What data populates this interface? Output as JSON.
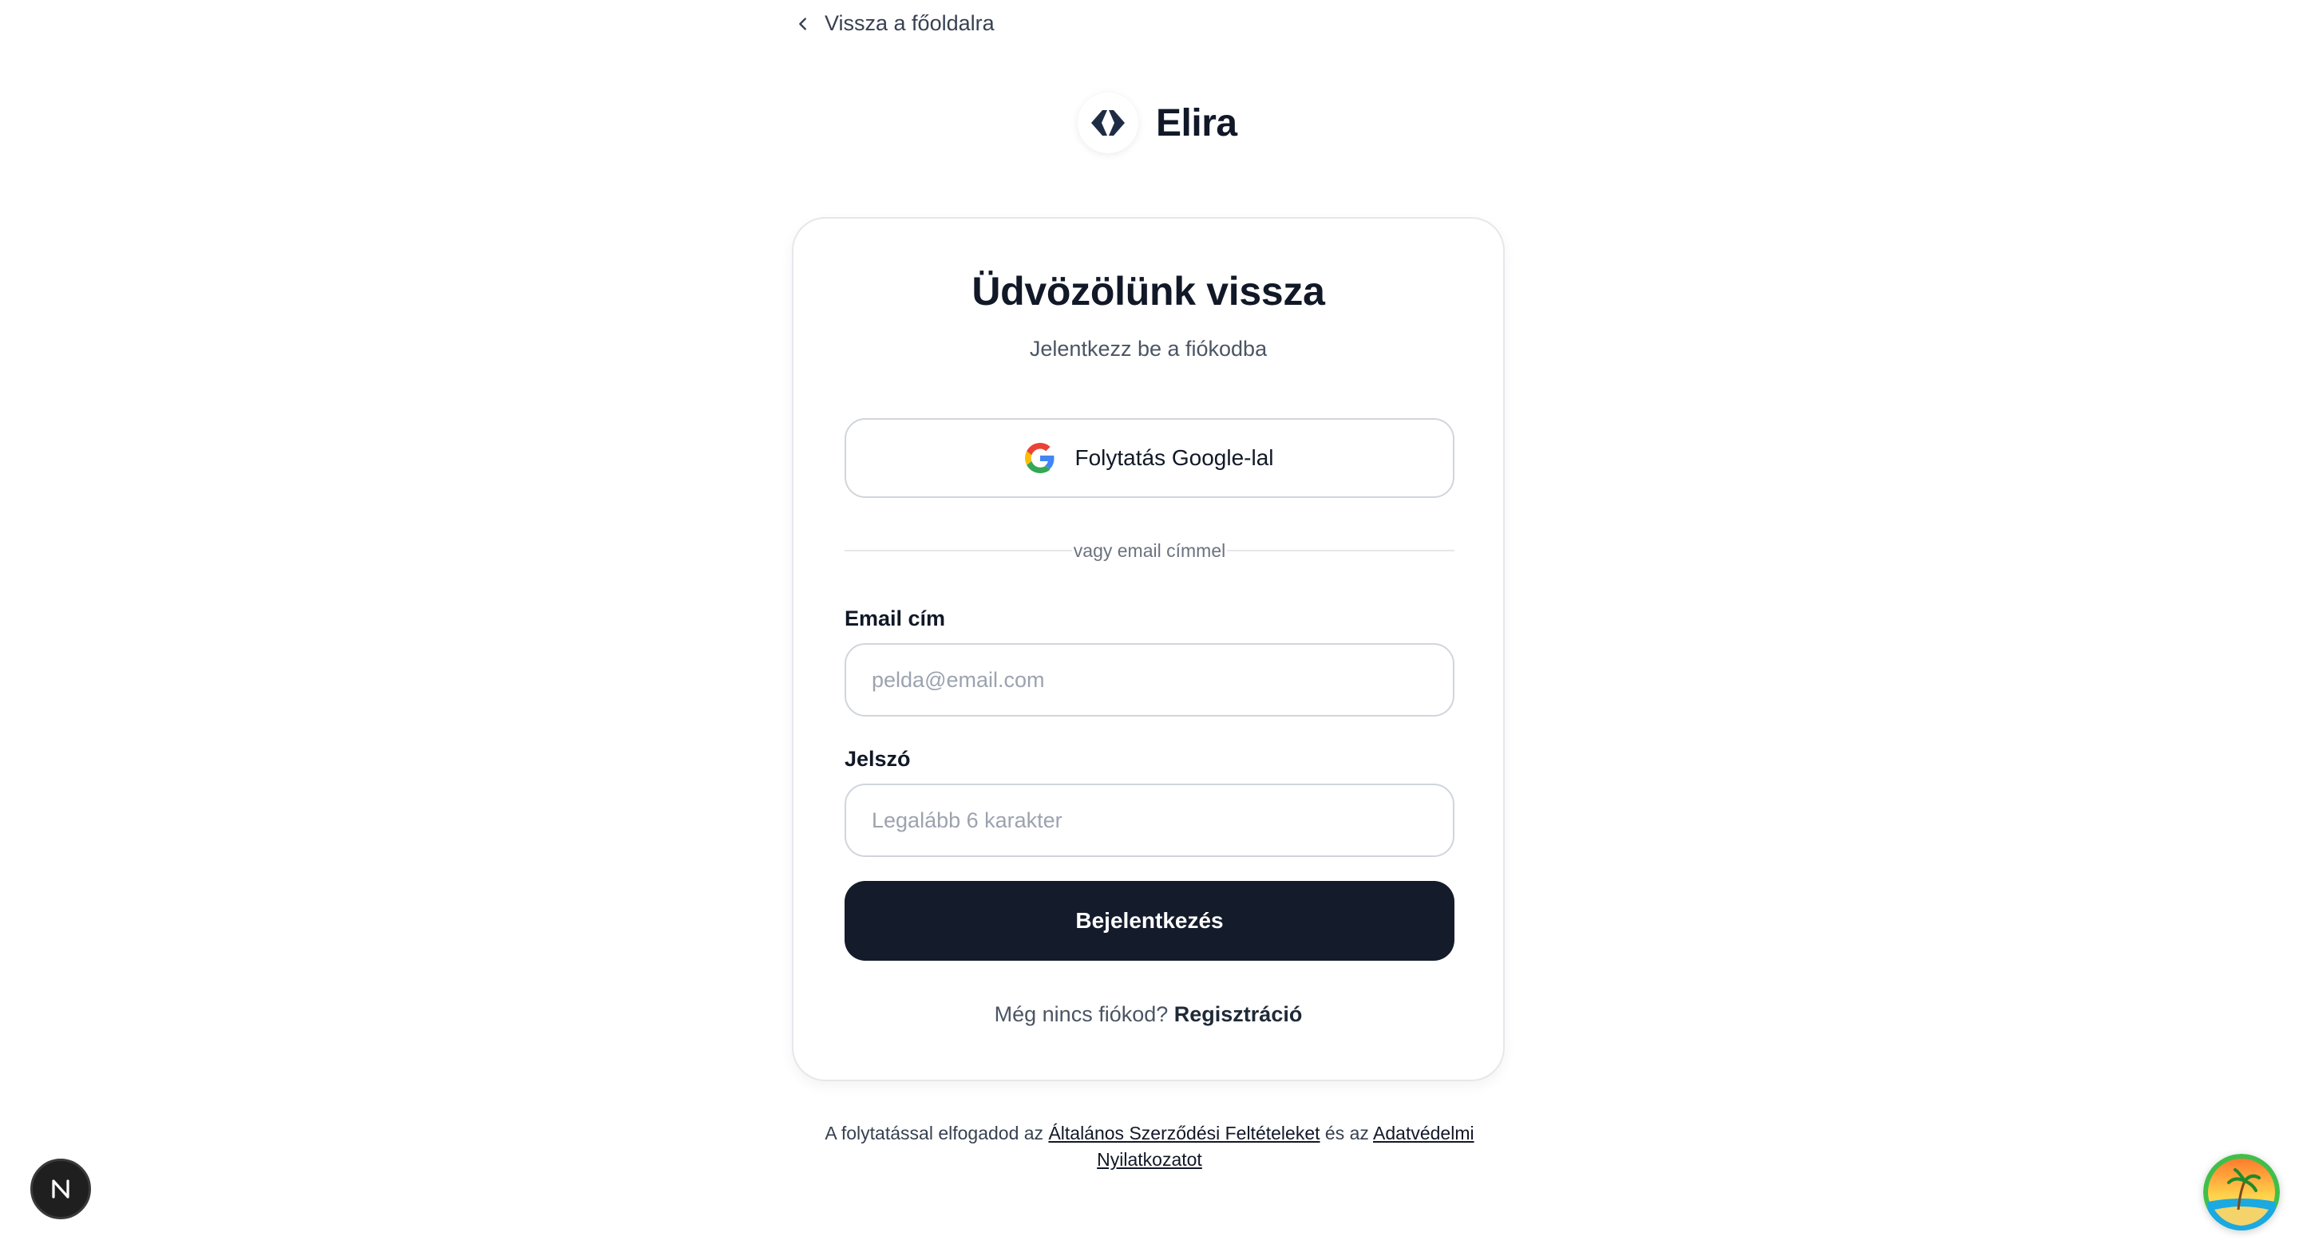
{
  "nav": {
    "back_label": "Vissza a főoldalra"
  },
  "brand": {
    "name": "Elira"
  },
  "card": {
    "title": "Üdvözölünk vissza",
    "subtitle": "Jelentkezz be a fiókodba",
    "google_button": "Folytatás Google-lal",
    "divider_text": "vagy email címmel",
    "email": {
      "label": "Email cím",
      "placeholder": "pelda@email.com",
      "value": ""
    },
    "password": {
      "label": "Jelszó",
      "placeholder": "Legalább 6 karakter",
      "value": ""
    },
    "submit": "Bejelentkezés",
    "signup_prompt": "Még nincs fiókod?",
    "signup_link": "Regisztráció"
  },
  "terms": {
    "prefix": "A folytatással elfogadod az",
    "terms_link": "Általános Szerződési Feltételeket",
    "middle": "és az",
    "privacy_link": "Adatvédelmi Nyilatkozatot"
  },
  "icons": {
    "back": "chevron-left-icon",
    "brand_logo": "elira-logo-icon",
    "google": "google-icon",
    "dev_badge": "nextjs-icon",
    "avatar": "beach-avatar-icon"
  },
  "colors": {
    "primary_button": "#141b2b",
    "border": "#d1d5db",
    "muted_text": "#4b5563"
  }
}
